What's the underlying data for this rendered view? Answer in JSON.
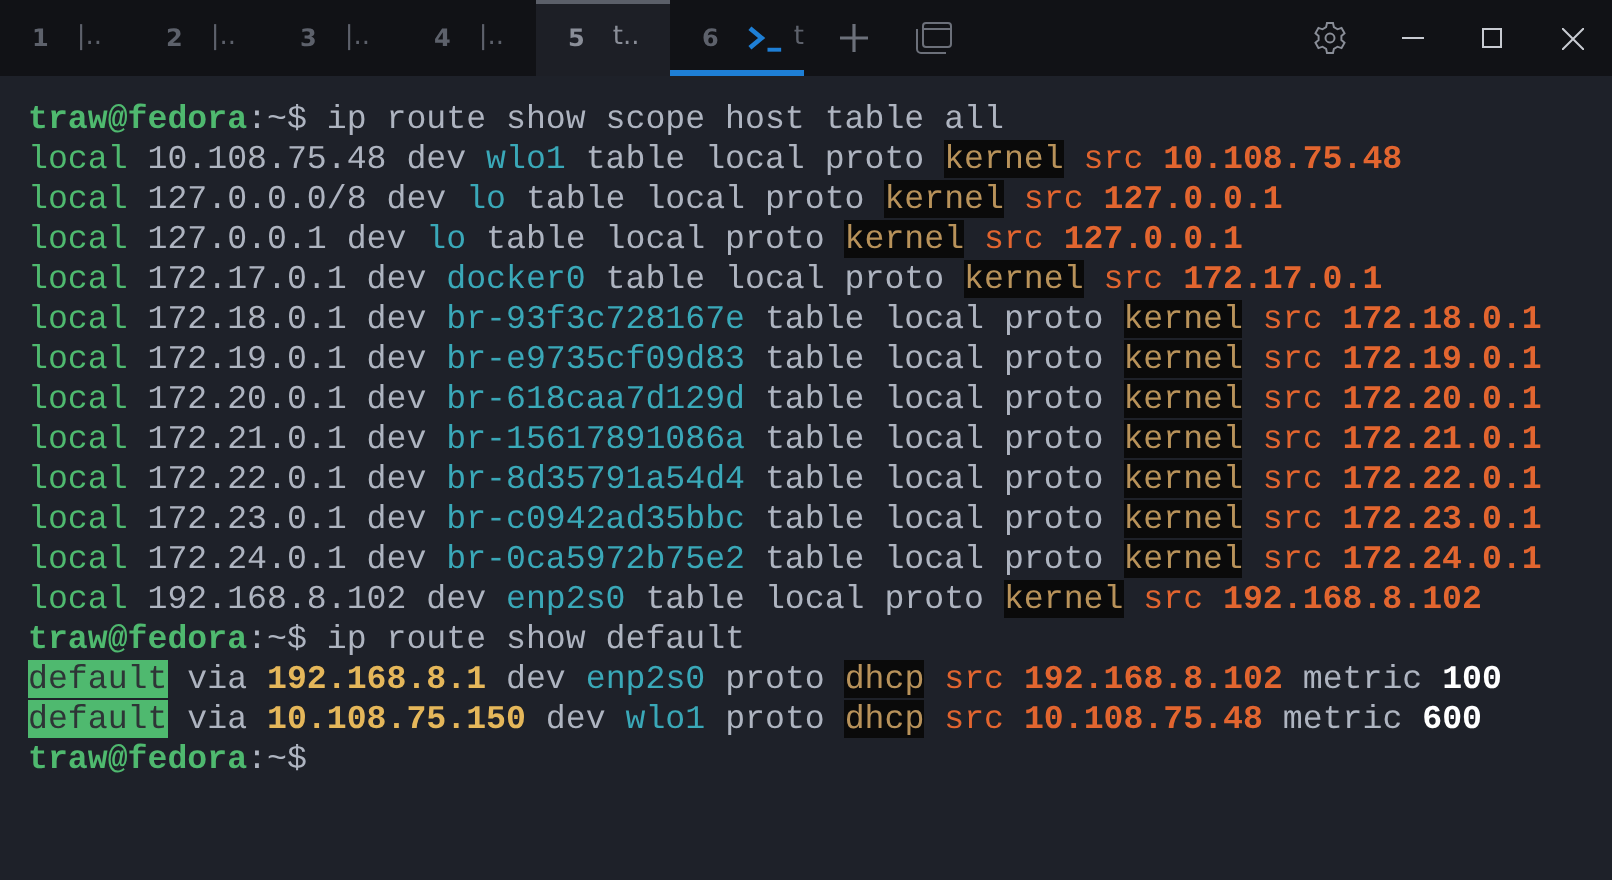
{
  "tabs": [
    {
      "number": "1",
      "label": "|..",
      "selected": false,
      "focused": false,
      "kind": "text"
    },
    {
      "number": "2",
      "label": "|..",
      "selected": false,
      "focused": false,
      "kind": "text"
    },
    {
      "number": "3",
      "label": "|..",
      "selected": false,
      "focused": false,
      "kind": "text"
    },
    {
      "number": "4",
      "label": "|..",
      "selected": false,
      "focused": false,
      "kind": "text"
    },
    {
      "number": "5",
      "label": "t..",
      "selected": true,
      "focused": false,
      "kind": "text"
    },
    {
      "number": "6",
      "label": "t",
      "selected": false,
      "focused": true,
      "kind": "terminal"
    }
  ],
  "terminal": {
    "lines": [
      [
        {
          "text": "traw@fedora",
          "kind": "prompt"
        },
        {
          "text": ":~$ ip route show scope host table all",
          "kind": "plain"
        }
      ],
      [
        {
          "text": "local",
          "kind": "green"
        },
        {
          "text": " 10.108.75.48 dev ",
          "kind": "plain"
        },
        {
          "text": "wlo1",
          "kind": "cyan"
        },
        {
          "text": " table local proto ",
          "kind": "plain"
        },
        {
          "text": "kernel",
          "kind": "boxed"
        },
        {
          "text": " src ",
          "kind": "orange"
        },
        {
          "text": "10.108.75.48",
          "kind": "orange-bold"
        }
      ],
      [
        {
          "text": "local",
          "kind": "green"
        },
        {
          "text": " 127.0.0.0/8 dev ",
          "kind": "plain"
        },
        {
          "text": "lo",
          "kind": "cyan"
        },
        {
          "text": " table local proto ",
          "kind": "plain"
        },
        {
          "text": "kernel",
          "kind": "boxed"
        },
        {
          "text": " src ",
          "kind": "orange"
        },
        {
          "text": "127.0.0.1",
          "kind": "orange-bold"
        }
      ],
      [
        {
          "text": "local",
          "kind": "green"
        },
        {
          "text": " 127.0.0.1 dev ",
          "kind": "plain"
        },
        {
          "text": "lo",
          "kind": "cyan"
        },
        {
          "text": " table local proto ",
          "kind": "plain"
        },
        {
          "text": "kernel",
          "kind": "boxed"
        },
        {
          "text": " src ",
          "kind": "orange"
        },
        {
          "text": "127.0.0.1",
          "kind": "orange-bold"
        }
      ],
      [
        {
          "text": "local",
          "kind": "green"
        },
        {
          "text": " 172.17.0.1 dev ",
          "kind": "plain"
        },
        {
          "text": "docker0",
          "kind": "cyan"
        },
        {
          "text": " table local proto ",
          "kind": "plain"
        },
        {
          "text": "kernel",
          "kind": "boxed"
        },
        {
          "text": " src ",
          "kind": "orange"
        },
        {
          "text": "172.17.0.1",
          "kind": "orange-bold"
        }
      ],
      [
        {
          "text": "local",
          "kind": "green"
        },
        {
          "text": " 172.18.0.1 dev ",
          "kind": "plain"
        },
        {
          "text": "br-93f3c728167e",
          "kind": "cyan"
        },
        {
          "text": " table local proto ",
          "kind": "plain"
        },
        {
          "text": "kernel",
          "kind": "boxed"
        },
        {
          "text": " src ",
          "kind": "orange"
        },
        {
          "text": "172.18.0.1",
          "kind": "orange-bold"
        }
      ],
      [
        {
          "text": "local",
          "kind": "green"
        },
        {
          "text": " 172.19.0.1 dev ",
          "kind": "plain"
        },
        {
          "text": "br-e9735cf09d83",
          "kind": "cyan"
        },
        {
          "text": " table local proto ",
          "kind": "plain"
        },
        {
          "text": "kernel",
          "kind": "boxed"
        },
        {
          "text": " src ",
          "kind": "orange"
        },
        {
          "text": "172.19.0.1",
          "kind": "orange-bold"
        }
      ],
      [
        {
          "text": "local",
          "kind": "green"
        },
        {
          "text": " 172.20.0.1 dev ",
          "kind": "plain"
        },
        {
          "text": "br-618caa7d129d",
          "kind": "cyan"
        },
        {
          "text": " table local proto ",
          "kind": "plain"
        },
        {
          "text": "kernel",
          "kind": "boxed"
        },
        {
          "text": " src ",
          "kind": "orange"
        },
        {
          "text": "172.20.0.1",
          "kind": "orange-bold"
        }
      ],
      [
        {
          "text": "local",
          "kind": "green"
        },
        {
          "text": " 172.21.0.1 dev ",
          "kind": "plain"
        },
        {
          "text": "br-15617891086a",
          "kind": "cyan"
        },
        {
          "text": " table local proto ",
          "kind": "plain"
        },
        {
          "text": "kernel",
          "kind": "boxed"
        },
        {
          "text": " src ",
          "kind": "orange"
        },
        {
          "text": "172.21.0.1",
          "kind": "orange-bold"
        }
      ],
      [
        {
          "text": "local",
          "kind": "green"
        },
        {
          "text": " 172.22.0.1 dev ",
          "kind": "plain"
        },
        {
          "text": "br-8d35791a54d4",
          "kind": "cyan"
        },
        {
          "text": " table local proto ",
          "kind": "plain"
        },
        {
          "text": "kernel",
          "kind": "boxed"
        },
        {
          "text": " src ",
          "kind": "orange"
        },
        {
          "text": "172.22.0.1",
          "kind": "orange-bold"
        }
      ],
      [
        {
          "text": "local",
          "kind": "green"
        },
        {
          "text": " 172.23.0.1 dev ",
          "kind": "plain"
        },
        {
          "text": "br-c0942ad35bbc",
          "kind": "cyan"
        },
        {
          "text": " table local proto ",
          "kind": "plain"
        },
        {
          "text": "kernel",
          "kind": "boxed"
        },
        {
          "text": " src ",
          "kind": "orange"
        },
        {
          "text": "172.23.0.1",
          "kind": "orange-bold"
        }
      ],
      [
        {
          "text": "local",
          "kind": "green"
        },
        {
          "text": " 172.24.0.1 dev ",
          "kind": "plain"
        },
        {
          "text": "br-0ca5972b75e2",
          "kind": "cyan"
        },
        {
          "text": " table local proto ",
          "kind": "plain"
        },
        {
          "text": "kernel",
          "kind": "boxed"
        },
        {
          "text": " src ",
          "kind": "orange"
        },
        {
          "text": "172.24.0.1",
          "kind": "orange-bold"
        }
      ],
      [
        {
          "text": "local",
          "kind": "green"
        },
        {
          "text": " 192.168.8.102 dev ",
          "kind": "plain"
        },
        {
          "text": "enp2s0",
          "kind": "cyan"
        },
        {
          "text": " table local proto ",
          "kind": "plain"
        },
        {
          "text": "kernel",
          "kind": "boxed"
        },
        {
          "text": " src ",
          "kind": "orange"
        },
        {
          "text": "192.168.8.102",
          "kind": "orange-bold"
        }
      ],
      [
        {
          "text": "traw@fedora",
          "kind": "prompt"
        },
        {
          "text": ":~$ ip route show default",
          "kind": "plain"
        }
      ],
      [
        {
          "text": "default",
          "kind": "highlight"
        },
        {
          "text": " via ",
          "kind": "plain"
        },
        {
          "text": "192.168.8.1",
          "kind": "yellow-bold"
        },
        {
          "text": " dev ",
          "kind": "plain"
        },
        {
          "text": "enp2s0",
          "kind": "cyan"
        },
        {
          "text": " proto ",
          "kind": "plain"
        },
        {
          "text": "dhcp",
          "kind": "boxed"
        },
        {
          "text": " src ",
          "kind": "orange"
        },
        {
          "text": "192.168.8.102",
          "kind": "orange-bold"
        },
        {
          "text": " metric ",
          "kind": "plain"
        },
        {
          "text": "100",
          "kind": "white-bold"
        }
      ],
      [
        {
          "text": "default",
          "kind": "highlight"
        },
        {
          "text": " via ",
          "kind": "plain"
        },
        {
          "text": "10.108.75.150",
          "kind": "yellow-bold"
        },
        {
          "text": " dev ",
          "kind": "plain"
        },
        {
          "text": "wlo1",
          "kind": "cyan"
        },
        {
          "text": " proto ",
          "kind": "plain"
        },
        {
          "text": "dhcp",
          "kind": "boxed"
        },
        {
          "text": " src ",
          "kind": "orange"
        },
        {
          "text": "10.108.75.48",
          "kind": "orange-bold"
        },
        {
          "text": " metric ",
          "kind": "plain"
        },
        {
          "text": "600",
          "kind": "white-bold"
        }
      ],
      [
        {
          "text": "traw@fedora",
          "kind": "prompt"
        },
        {
          "text": ":~$",
          "kind": "plain"
        }
      ]
    ]
  }
}
